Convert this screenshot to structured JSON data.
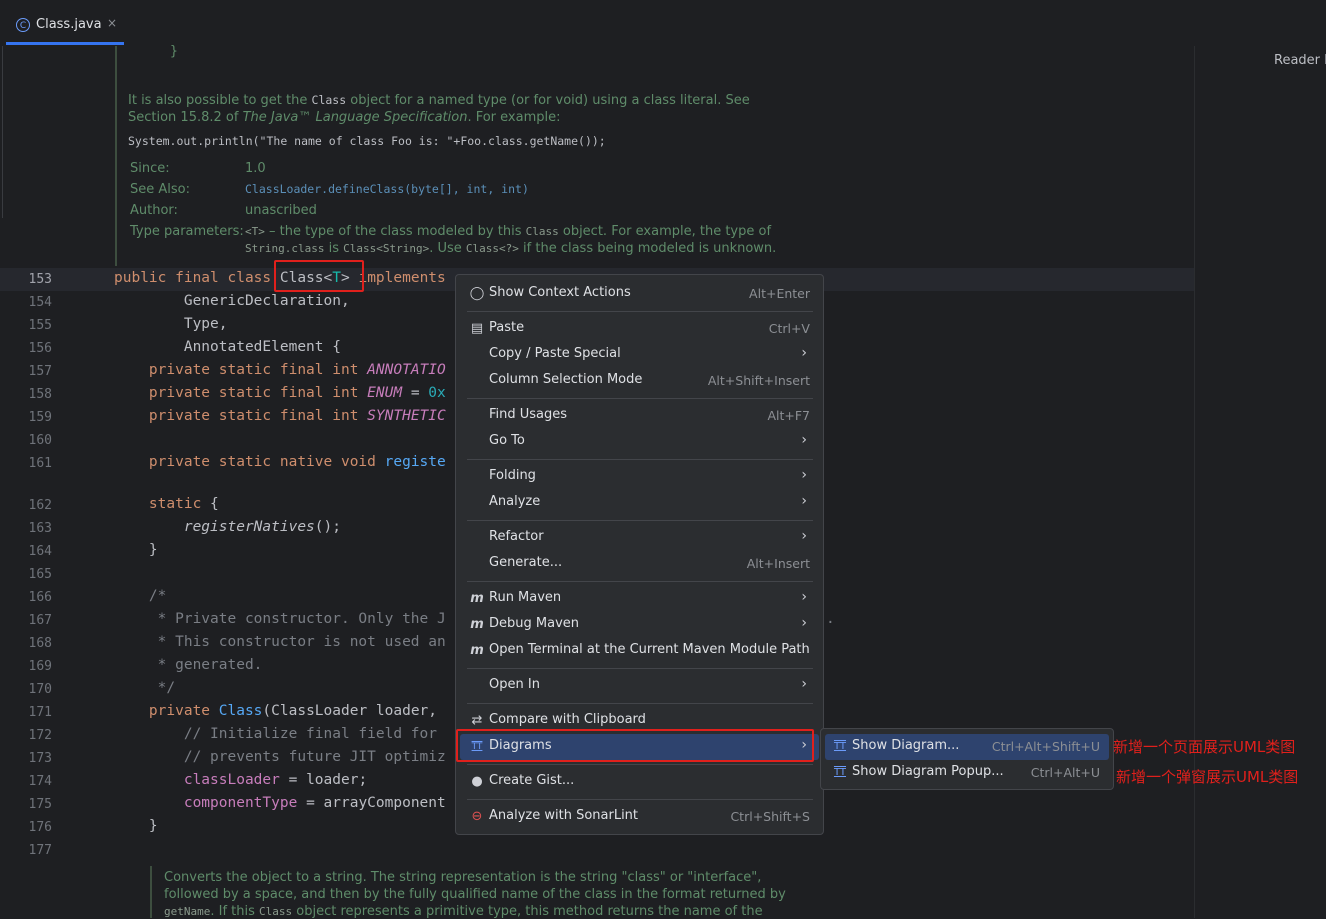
{
  "tab": {
    "label": "Class.java",
    "close": "×",
    "icon_letter": "C"
  },
  "reader_label": "Reader M",
  "doc": {
    "brace": "}",
    "p1a": "It is also possible to get the ",
    "p1code": "Class",
    "p1b": " object for a named type (or for void) using a class literal. See",
    "p2a": "Section 15.8.2 of ",
    "p2i": "The Java™ Language Specification",
    "p2b": ". For example:",
    "example": "System.out.println(\"The name of class Foo is: \"+Foo.class.getName());",
    "since_label": "Since:",
    "since_value": "1.0",
    "seealso_label": "See Also:",
    "seealso_value": "ClassLoader.defineClass(byte[], int, int)",
    "author_label": "Author:",
    "author_value": "unascribed",
    "typeparams_label": "Type parameters:",
    "tp1_code": "<T>",
    "tp1_text": " – the type of the class modeled by this ",
    "tp1_code2": "Class",
    "tp1_text2": " object. For example, the type of",
    "tp2_code": "String.class",
    "tp2_text": " is ",
    "tp2_code2": "Class<String>",
    "tp2_text2": ". Use ",
    "tp2_code3": "Class<?>",
    "tp2_text3": " if the class being modeled is unknown.",
    "bottom1": "Converts the object to a string. The string representation is the string \"class\" or \"interface\",",
    "bottom2": "followed by a space, and then by the fully qualified name of the class in the format returned by",
    "bottom3a": "getName",
    "bottom3b": ". If this ",
    "bottom3c": "Class",
    "bottom3d": " object represents a primitive type, this method returns the name of the"
  },
  "code": {
    "l153_a": "public final class ",
    "l153_b": "Class<",
    "l153_t": "T",
    "l153_c": ">",
    "l153_d": " implements",
    "l154": "        GenericDeclaration,",
    "l155": "        Type,",
    "l156": "        AnnotatedElement {",
    "l157_kw": "    private static final int ",
    "l157_c": "ANNOTATIO",
    "l158_kw": "    private static final int ",
    "l158_c": "ENUM",
    "l158_e": " = ",
    "l158_n": "0x",
    "l159_kw": "    private static final int ",
    "l159_c": "SYNTHETIC",
    "l161_kw": "    private static native void ",
    "l161_f": "registe",
    "l162_kw": "    static",
    "l162_r": " {",
    "l163_a": "        ",
    "l163_f": "registerNatives",
    "l163_b": "();",
    "l164": "    }",
    "l166": "    /*",
    "l167": "     * Private constructor. Only the J",
    "l168": "     * This constructor is not used an",
    "l169": "     * generated.",
    "l170": "     */",
    "l171_kw": "    private ",
    "l171_c": "Class",
    "l171_r": "(ClassLoader loader,",
    "l172": "        // Initialize final field for",
    "l173": "        // prevents future JIT optimiz",
    "l174_a": "        ",
    "l174_f": "classLoader",
    "l174_b": " = loader;",
    "l175_a": "        ",
    "l175_f": "componentType",
    "l175_b": " = arrayComponent",
    "l176": "    }",
    "stray_dot": "."
  },
  "line_numbers": [
    "153",
    "154",
    "155",
    "156",
    "157",
    "158",
    "159",
    "160",
    "161",
    "162",
    "163",
    "164",
    "165",
    "166",
    "167",
    "168",
    "169",
    "170",
    "171",
    "172",
    "173",
    "174",
    "175",
    "176",
    "177"
  ],
  "menu": {
    "items": [
      {
        "label": "Show Context Actions",
        "shortcut": "Alt+Enter",
        "icon": "bulb-icon",
        "glyph": "💡"
      },
      {
        "label": "Paste",
        "shortcut": "Ctrl+V",
        "icon": "clipboard-icon",
        "glyph": "📋"
      },
      {
        "label": "Copy / Paste Special",
        "arrow": "›"
      },
      {
        "label": "Column Selection Mode",
        "shortcut": "Alt+Shift+Insert"
      },
      {
        "label": "Find Usages",
        "shortcut": "Alt+F7"
      },
      {
        "label": "Go To",
        "arrow": "›"
      },
      {
        "label": "Folding",
        "arrow": "›"
      },
      {
        "label": "Analyze",
        "arrow": "›"
      },
      {
        "label": "Refactor",
        "arrow": "›"
      },
      {
        "label": "Generate...",
        "shortcut": "Alt+Insert"
      },
      {
        "label": "Run Maven",
        "arrow": "›",
        "icon": "maven-run-icon",
        "glyph": "m"
      },
      {
        "label": "Debug Maven",
        "arrow": "›",
        "icon": "maven-debug-icon",
        "glyph": "m"
      },
      {
        "label": "Open Terminal at the Current Maven Module Path",
        "icon": "maven-terminal-icon",
        "glyph": "m"
      },
      {
        "label": "Open In",
        "arrow": "›"
      },
      {
        "label": "Compare with Clipboard",
        "icon": "compare-icon",
        "glyph": "⇄"
      },
      {
        "label": "Diagrams",
        "arrow": "›",
        "icon": "diagram-icon",
        "glyph": "TT"
      },
      {
        "label": "Create Gist...",
        "icon": "github-icon",
        "glyph": "●"
      },
      {
        "label": "Analyze with SonarLint",
        "shortcut": "Ctrl+Shift+S",
        "icon": "sonarlint-icon",
        "glyph": "⊖"
      }
    ]
  },
  "submenu": {
    "items": [
      {
        "label": "Show Diagram...",
        "shortcut": "Ctrl+Alt+Shift+U",
        "glyph": "TT"
      },
      {
        "label": "Show Diagram Popup...",
        "shortcut": "Ctrl+Alt+U",
        "glyph": "TT"
      }
    ]
  },
  "annotations": {
    "a1": "新增一个页面展示UML类图",
    "a2": "新增一个弹窗展示UML类图"
  },
  "colors": {
    "accent": "#3574f0",
    "selection": "#2e436e",
    "annotation_red": "#e0201c"
  }
}
